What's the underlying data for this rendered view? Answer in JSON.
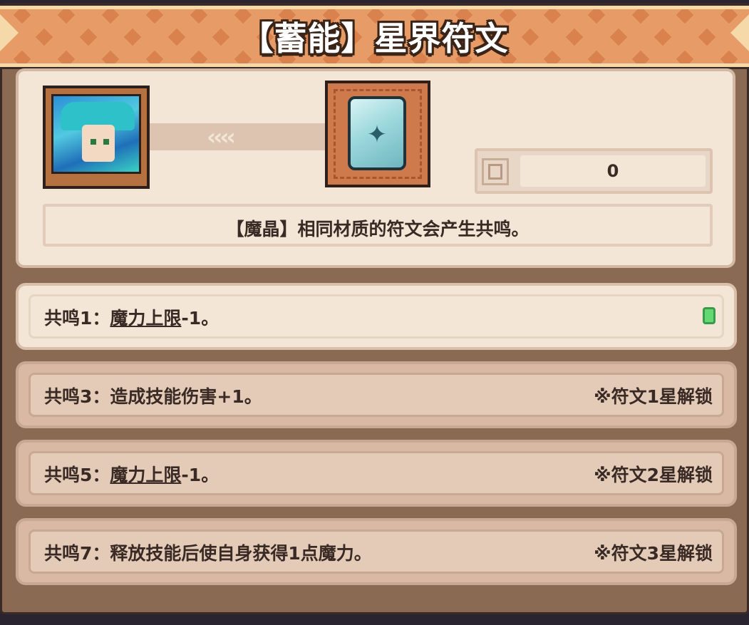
{
  "header": {
    "title": "【蓄能】星界符文"
  },
  "rune": {
    "counter_value": "0",
    "description": "【魔晶】相同材质的符文会产生共鸣。",
    "arrows": "‹‹‹‹"
  },
  "resonances": [
    {
      "prefix": "共鸣1：",
      "link": "魔力上限",
      "suffix": "-1。",
      "lock": "",
      "active": true
    },
    {
      "prefix": "共鸣3：",
      "link": "",
      "suffix": "造成技能伤害+1。",
      "lock": "※符文1星解锁",
      "active": false
    },
    {
      "prefix": "共鸣5：",
      "link": "魔力上限",
      "suffix": "-1。",
      "lock": "※符文2星解锁",
      "active": false
    },
    {
      "prefix": "共鸣7：",
      "link": "",
      "suffix": "释放技能后使自身获得1点魔力。",
      "lock": "※符文3星解锁",
      "active": false
    }
  ],
  "colors": {
    "banner": "#d9824e",
    "panel": "#f3e6d6",
    "frame": "#8a6a53",
    "active_gem": "#63d873"
  }
}
